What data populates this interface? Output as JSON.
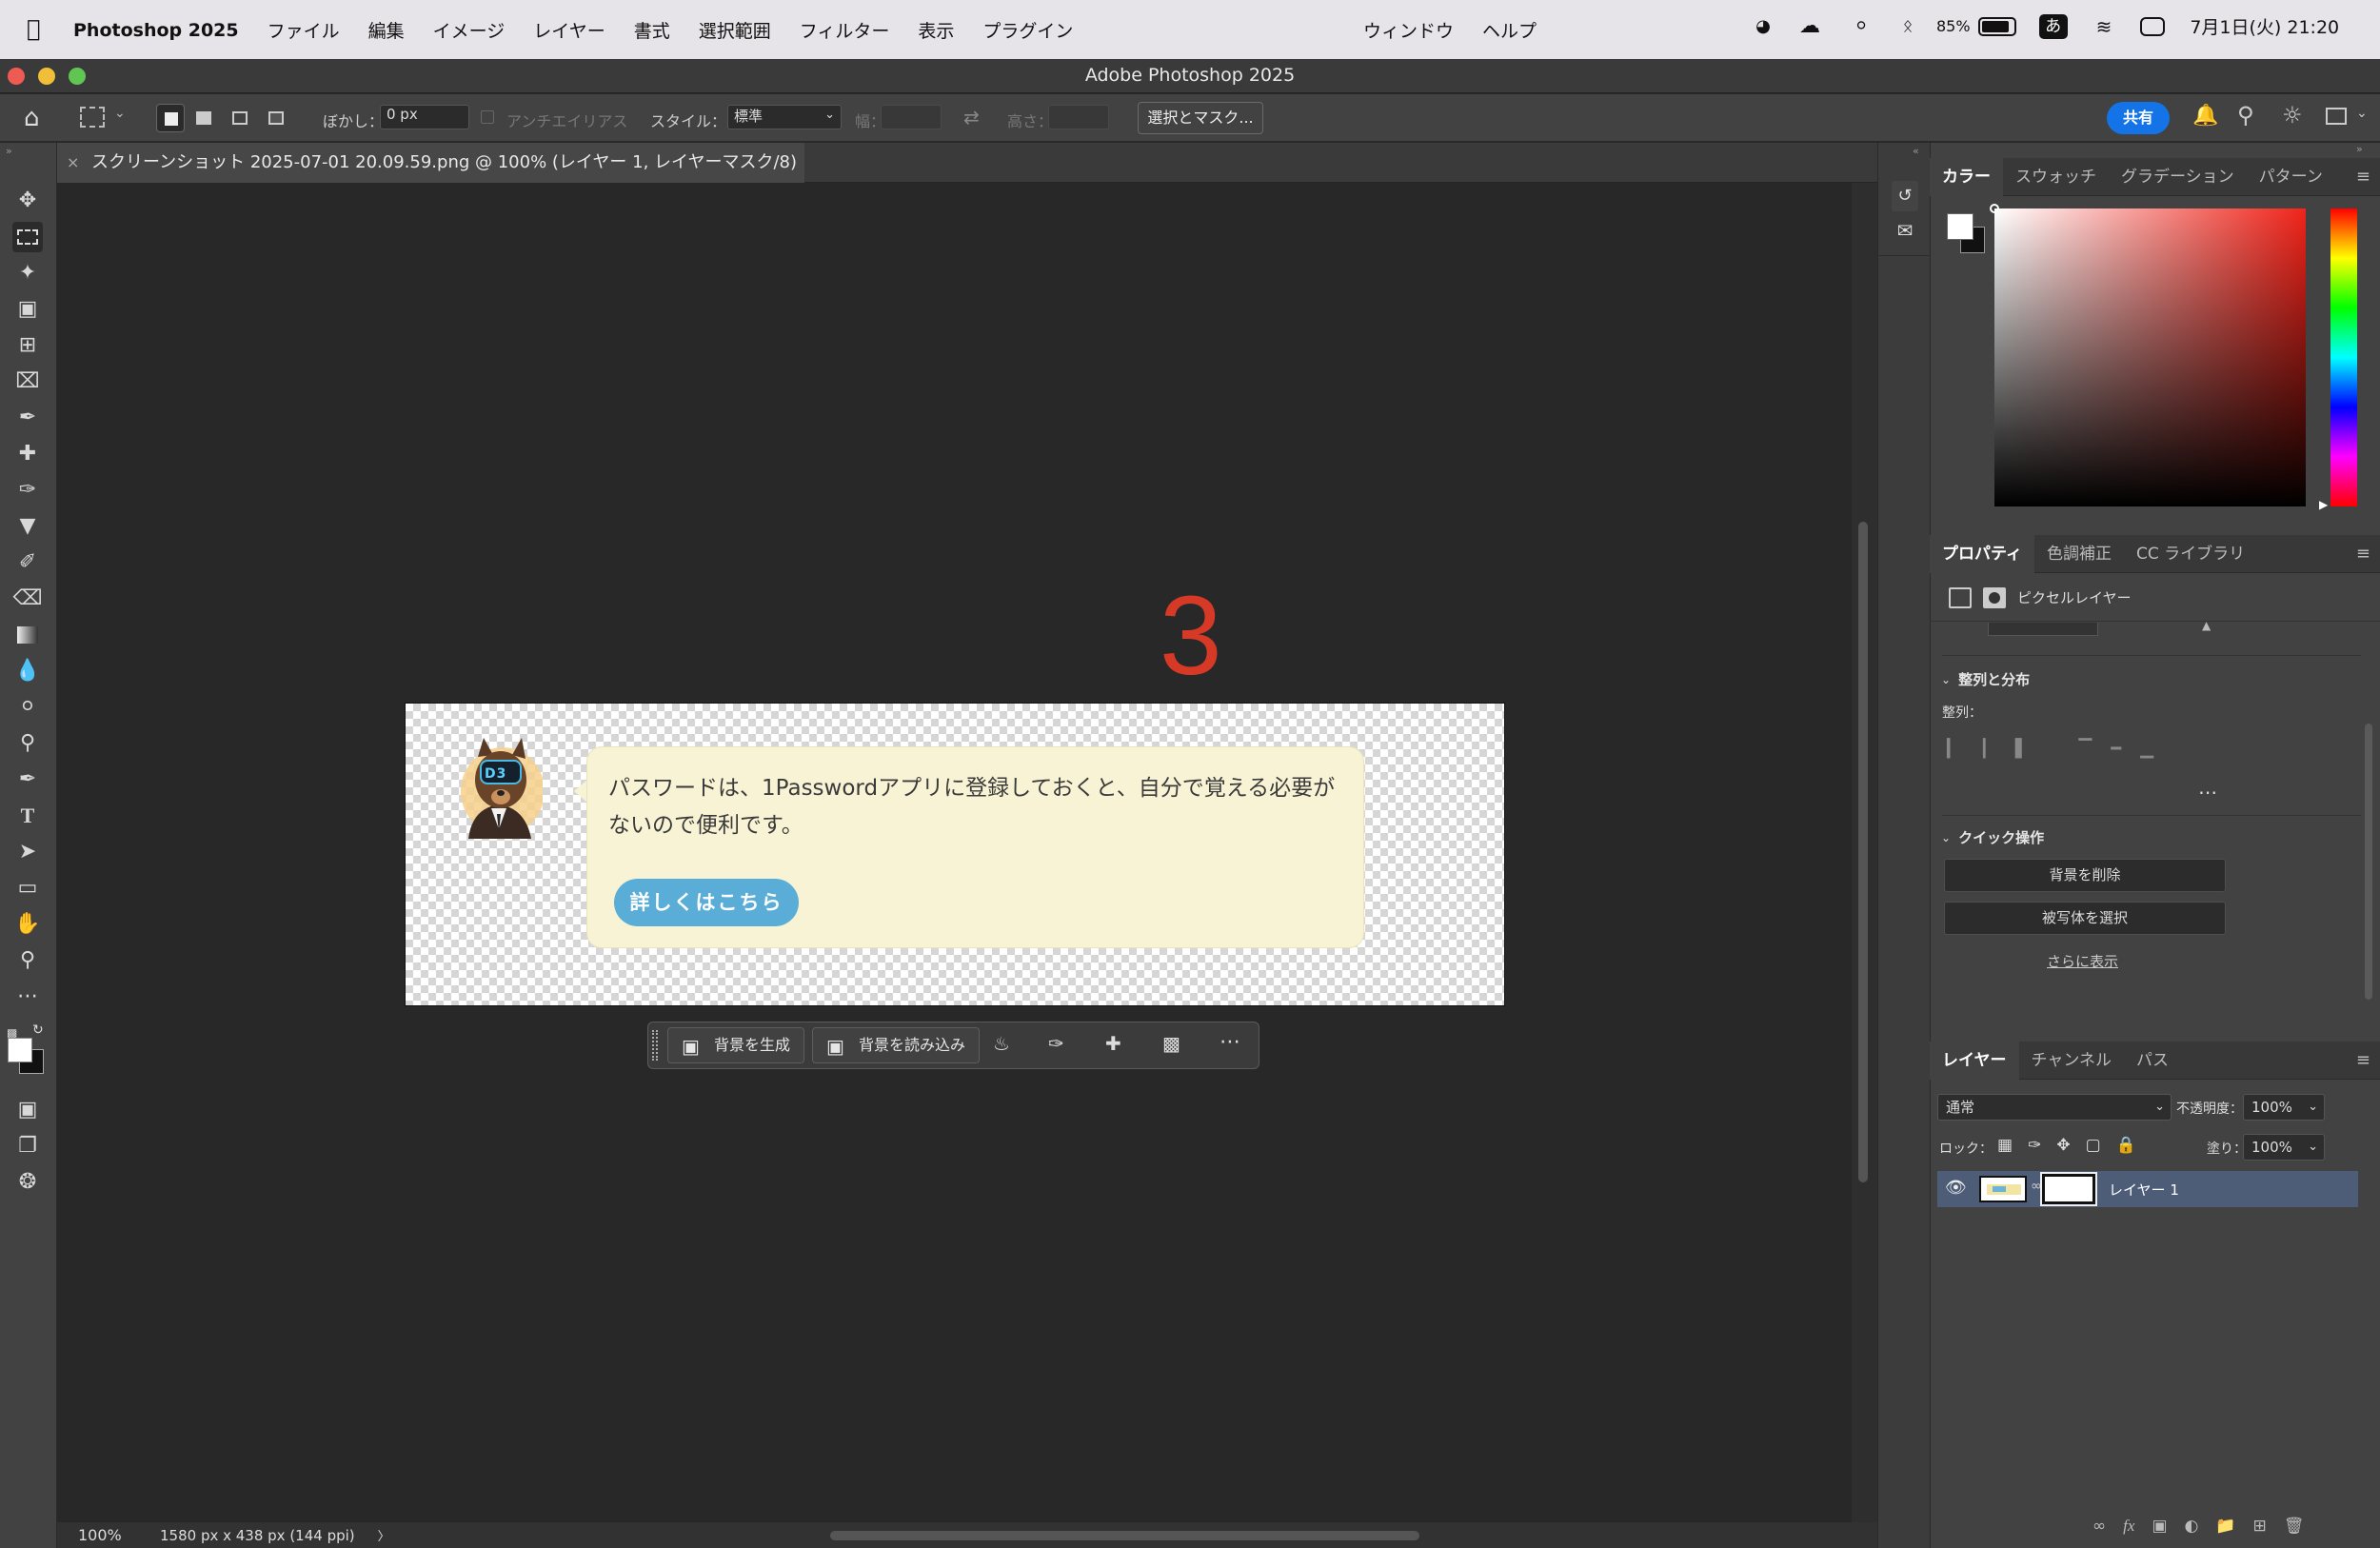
{
  "menubar": {
    "app": "Photoshop 2025",
    "items": [
      "ファイル",
      "編集",
      "イメージ",
      "レイヤー",
      "書式",
      "選択範囲",
      "フィルター",
      "表示",
      "プラグイン"
    ],
    "items_right": [
      "ウィンドウ",
      "ヘルプ"
    ],
    "battery": "85%",
    "ime": "あ",
    "clock": "7月1日(火) 21:20"
  },
  "window": {
    "title": "Adobe Photoshop 2025"
  },
  "options": {
    "feather_label": "ぼかし：",
    "feather_value": "0 px",
    "antialias": "アンチエイリアス",
    "style_label": "スタイル：",
    "style_value": "標準",
    "width_label": "幅：",
    "height_label": "高さ：",
    "select_mask": "選択とマスク...",
    "share": "共有"
  },
  "document": {
    "tab": "スクリーンショット 2025-07-01 20.09.59.png @ 100% (レイヤー 1, レイヤーマスク/8) *",
    "close": "×"
  },
  "canvas": {
    "annotation_number": "3",
    "message_line1": "パスワードは、1Passwordアプリに登録しておくと、自分で覚える必要が",
    "message_line2": "ないので便利です。",
    "button": "詳しくはこちら",
    "avatar_badge": "D3"
  },
  "ctxbar": {
    "generate_bg": "背景を生成",
    "import_bg": "背景を読み込み"
  },
  "status": {
    "zoom": "100%",
    "doc_info": "1580 px x 438 px (144 ppi)",
    "arrow": "〉"
  },
  "color_panel": {
    "tabs": [
      "カラー",
      "スウォッチ",
      "グラデーション",
      "パターン"
    ]
  },
  "properties": {
    "tabs": [
      "プロパティ",
      "色調補正",
      "CC ライブラリ"
    ],
    "kind": "ピクセルレイヤー",
    "align_header": "整列と分布",
    "align_label": "整列：",
    "quick_header": "クイック操作",
    "remove_bg": "背景を削除",
    "select_subject": "被写体を選択",
    "show_more": "さらに表示"
  },
  "layers": {
    "tabs": [
      "レイヤー",
      "チャンネル",
      "パス"
    ],
    "blend": "通常",
    "opacity_label": "不透明度：",
    "opacity": "100%",
    "lock_label": "ロック：",
    "fill_label": "塗り：",
    "fill": "100%",
    "layer_name": "レイヤー 1"
  },
  "colors": {
    "accent": "#d63a26",
    "bubble": "#f8f3d4",
    "button": "#5aadd6",
    "share": "#1473e6",
    "layer_selected": "#4d5c77"
  }
}
